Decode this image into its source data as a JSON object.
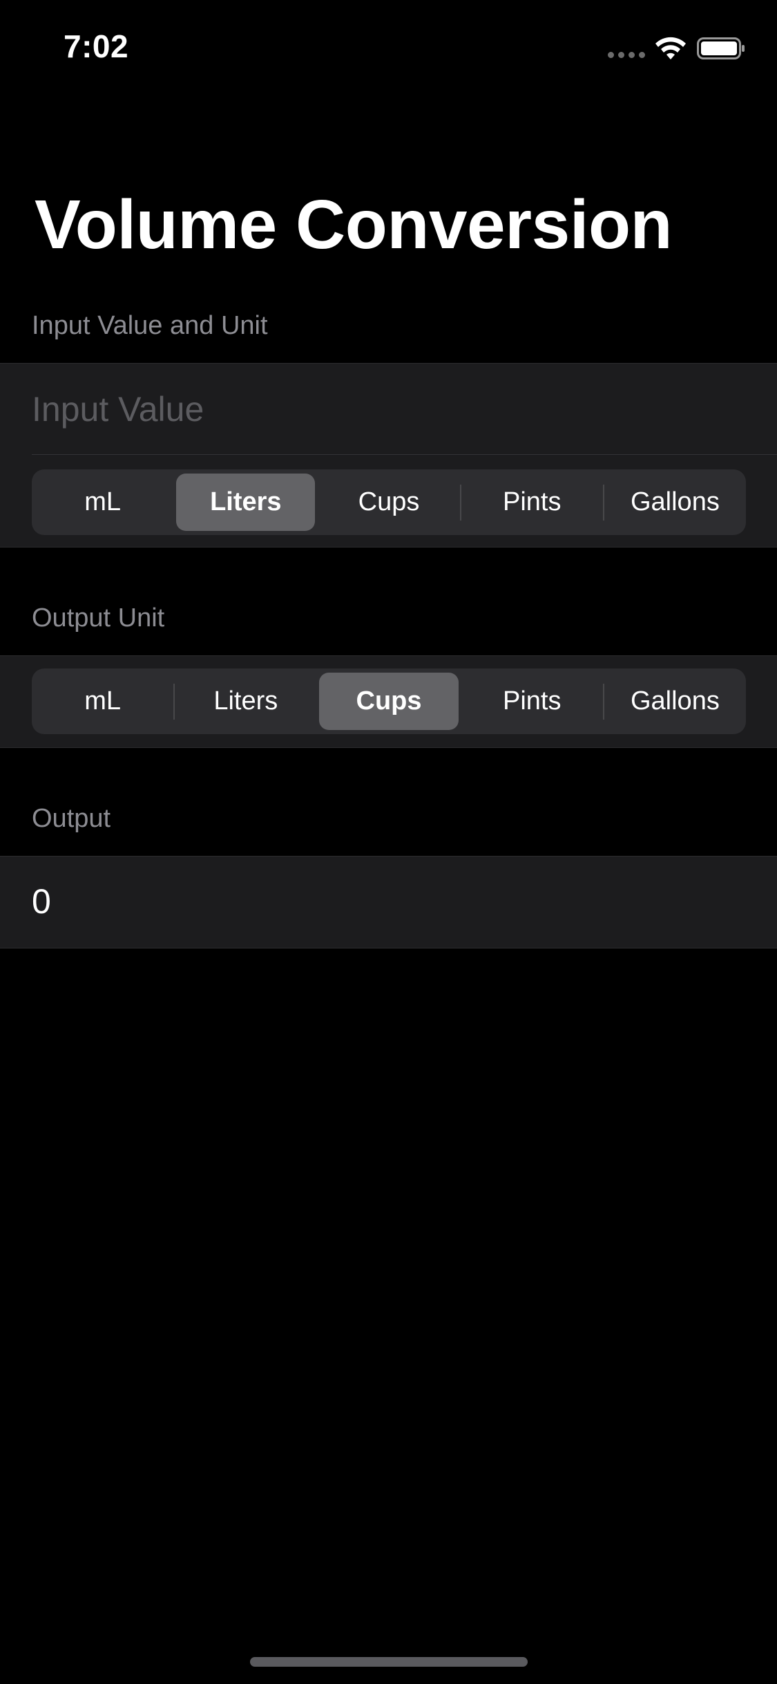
{
  "status_bar": {
    "time": "7:02",
    "icons": [
      "signal-dots-icon",
      "wifi-icon",
      "battery-icon"
    ]
  },
  "title": "Volume Conversion",
  "input_section": {
    "header": "Input Value and Unit",
    "placeholder": "Input Value",
    "value": "",
    "units": [
      "mL",
      "Liters",
      "Cups",
      "Pints",
      "Gallons"
    ],
    "selected": "Liters"
  },
  "output_unit_section": {
    "header": "Output Unit",
    "units": [
      "mL",
      "Liters",
      "Cups",
      "Pints",
      "Gallons"
    ],
    "selected": "Cups"
  },
  "output_section": {
    "header": "Output",
    "value": "0"
  },
  "colors": {
    "background": "#000000",
    "group_background": "#1c1c1e",
    "segment_track": "#2d2d30",
    "segment_selected": "#636366",
    "secondary_text": "#8d8d93",
    "placeholder_text": "#5c5c60"
  }
}
